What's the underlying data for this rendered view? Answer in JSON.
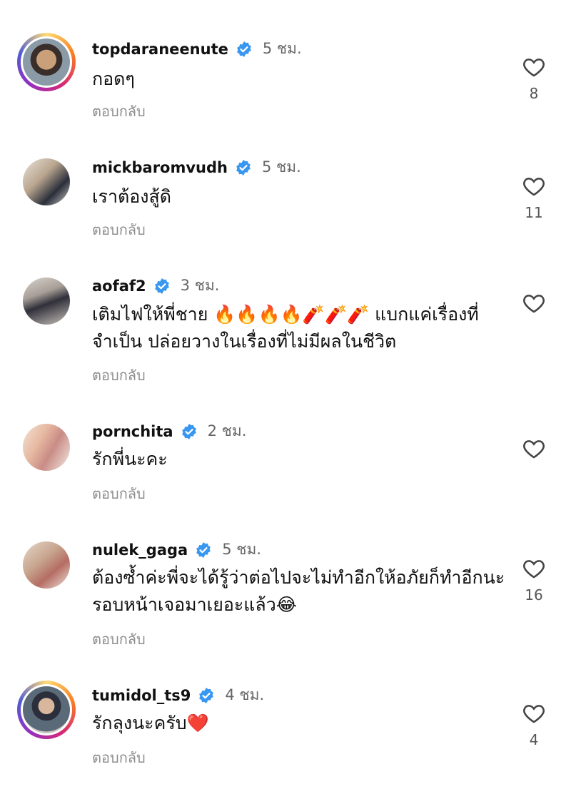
{
  "comments": [
    {
      "username": "topdaraneenute",
      "time": "5 ชม.",
      "text": "กอดๆ",
      "reply": "ตอบกลับ",
      "likes": "8",
      "story_ring": true
    },
    {
      "username": "mickbaromvudh",
      "time": "5 ชม.",
      "text": "เราต้องสู้ดิ",
      "reply": "ตอบกลับ",
      "likes": "11",
      "story_ring": false
    },
    {
      "username": "aofaf2",
      "time": "3 ชม.",
      "text": "เติมไฟให้พี่ชาย 🔥🔥🔥🔥🧨🧨🧨 แบกแค่เรื่องที่จำเป็น ปล่อยวางในเรื่องที่ไม่มีผลในชีวิต",
      "reply": "ตอบกลับ",
      "likes": "",
      "story_ring": false
    },
    {
      "username": "pornchita",
      "time": "2 ชม.",
      "text": "รักพี่นะคะ",
      "reply": "ตอบกลับ",
      "likes": "",
      "story_ring": false
    },
    {
      "username": "nulek_gaga",
      "time": "5 ชม.",
      "text": "ต้องซ้ำค่ะพี่จะได้รู้ว่าต่อไปจะไม่ทำอีกให้อภัยก็ทำอีกนะรอบหน้าเจอมาเยอะแล้ว😂",
      "reply": "ตอบกลับ",
      "likes": "16",
      "story_ring": false
    },
    {
      "username": "tumidol_ts9",
      "time": "4 ชม.",
      "text": "รักลุงนะครับ❤️",
      "reply": "ตอบกลับ",
      "likes": "4",
      "story_ring": true
    }
  ],
  "icons": {
    "verified": "verified-badge-icon",
    "like": "heart-outline-icon"
  },
  "colors": {
    "verified": "#3897f0",
    "secondary_text": "#8e8e8e"
  }
}
